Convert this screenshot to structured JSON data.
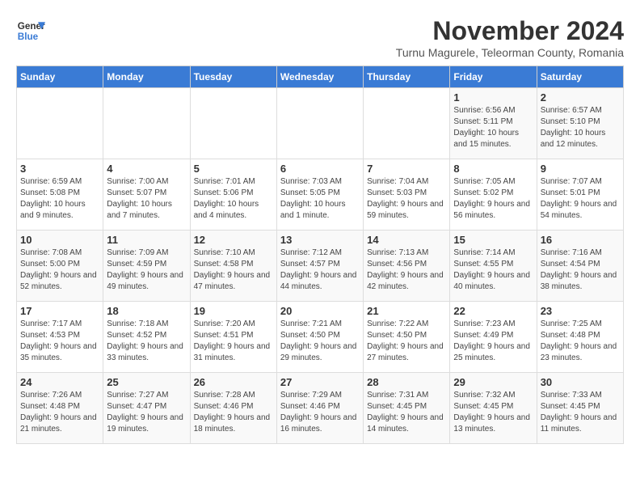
{
  "logo": {
    "text_general": "General",
    "text_blue": "Blue"
  },
  "title": "November 2024",
  "subtitle": "Turnu Magurele, Teleorman County, Romania",
  "days_of_week": [
    "Sunday",
    "Monday",
    "Tuesday",
    "Wednesday",
    "Thursday",
    "Friday",
    "Saturday"
  ],
  "weeks": [
    [
      {
        "day": "",
        "info": ""
      },
      {
        "day": "",
        "info": ""
      },
      {
        "day": "",
        "info": ""
      },
      {
        "day": "",
        "info": ""
      },
      {
        "day": "",
        "info": ""
      },
      {
        "day": "1",
        "info": "Sunrise: 6:56 AM\nSunset: 5:11 PM\nDaylight: 10 hours and 15 minutes."
      },
      {
        "day": "2",
        "info": "Sunrise: 6:57 AM\nSunset: 5:10 PM\nDaylight: 10 hours and 12 minutes."
      }
    ],
    [
      {
        "day": "3",
        "info": "Sunrise: 6:59 AM\nSunset: 5:08 PM\nDaylight: 10 hours and 9 minutes."
      },
      {
        "day": "4",
        "info": "Sunrise: 7:00 AM\nSunset: 5:07 PM\nDaylight: 10 hours and 7 minutes."
      },
      {
        "day": "5",
        "info": "Sunrise: 7:01 AM\nSunset: 5:06 PM\nDaylight: 10 hours and 4 minutes."
      },
      {
        "day": "6",
        "info": "Sunrise: 7:03 AM\nSunset: 5:05 PM\nDaylight: 10 hours and 1 minute."
      },
      {
        "day": "7",
        "info": "Sunrise: 7:04 AM\nSunset: 5:03 PM\nDaylight: 9 hours and 59 minutes."
      },
      {
        "day": "8",
        "info": "Sunrise: 7:05 AM\nSunset: 5:02 PM\nDaylight: 9 hours and 56 minutes."
      },
      {
        "day": "9",
        "info": "Sunrise: 7:07 AM\nSunset: 5:01 PM\nDaylight: 9 hours and 54 minutes."
      }
    ],
    [
      {
        "day": "10",
        "info": "Sunrise: 7:08 AM\nSunset: 5:00 PM\nDaylight: 9 hours and 52 minutes."
      },
      {
        "day": "11",
        "info": "Sunrise: 7:09 AM\nSunset: 4:59 PM\nDaylight: 9 hours and 49 minutes."
      },
      {
        "day": "12",
        "info": "Sunrise: 7:10 AM\nSunset: 4:58 PM\nDaylight: 9 hours and 47 minutes."
      },
      {
        "day": "13",
        "info": "Sunrise: 7:12 AM\nSunset: 4:57 PM\nDaylight: 9 hours and 44 minutes."
      },
      {
        "day": "14",
        "info": "Sunrise: 7:13 AM\nSunset: 4:56 PM\nDaylight: 9 hours and 42 minutes."
      },
      {
        "day": "15",
        "info": "Sunrise: 7:14 AM\nSunset: 4:55 PM\nDaylight: 9 hours and 40 minutes."
      },
      {
        "day": "16",
        "info": "Sunrise: 7:16 AM\nSunset: 4:54 PM\nDaylight: 9 hours and 38 minutes."
      }
    ],
    [
      {
        "day": "17",
        "info": "Sunrise: 7:17 AM\nSunset: 4:53 PM\nDaylight: 9 hours and 35 minutes."
      },
      {
        "day": "18",
        "info": "Sunrise: 7:18 AM\nSunset: 4:52 PM\nDaylight: 9 hours and 33 minutes."
      },
      {
        "day": "19",
        "info": "Sunrise: 7:20 AM\nSunset: 4:51 PM\nDaylight: 9 hours and 31 minutes."
      },
      {
        "day": "20",
        "info": "Sunrise: 7:21 AM\nSunset: 4:50 PM\nDaylight: 9 hours and 29 minutes."
      },
      {
        "day": "21",
        "info": "Sunrise: 7:22 AM\nSunset: 4:50 PM\nDaylight: 9 hours and 27 minutes."
      },
      {
        "day": "22",
        "info": "Sunrise: 7:23 AM\nSunset: 4:49 PM\nDaylight: 9 hours and 25 minutes."
      },
      {
        "day": "23",
        "info": "Sunrise: 7:25 AM\nSunset: 4:48 PM\nDaylight: 9 hours and 23 minutes."
      }
    ],
    [
      {
        "day": "24",
        "info": "Sunrise: 7:26 AM\nSunset: 4:48 PM\nDaylight: 9 hours and 21 minutes."
      },
      {
        "day": "25",
        "info": "Sunrise: 7:27 AM\nSunset: 4:47 PM\nDaylight: 9 hours and 19 minutes."
      },
      {
        "day": "26",
        "info": "Sunrise: 7:28 AM\nSunset: 4:46 PM\nDaylight: 9 hours and 18 minutes."
      },
      {
        "day": "27",
        "info": "Sunrise: 7:29 AM\nSunset: 4:46 PM\nDaylight: 9 hours and 16 minutes."
      },
      {
        "day": "28",
        "info": "Sunrise: 7:31 AM\nSunset: 4:45 PM\nDaylight: 9 hours and 14 minutes."
      },
      {
        "day": "29",
        "info": "Sunrise: 7:32 AM\nSunset: 4:45 PM\nDaylight: 9 hours and 13 minutes."
      },
      {
        "day": "30",
        "info": "Sunrise: 7:33 AM\nSunset: 4:45 PM\nDaylight: 9 hours and 11 minutes."
      }
    ]
  ]
}
